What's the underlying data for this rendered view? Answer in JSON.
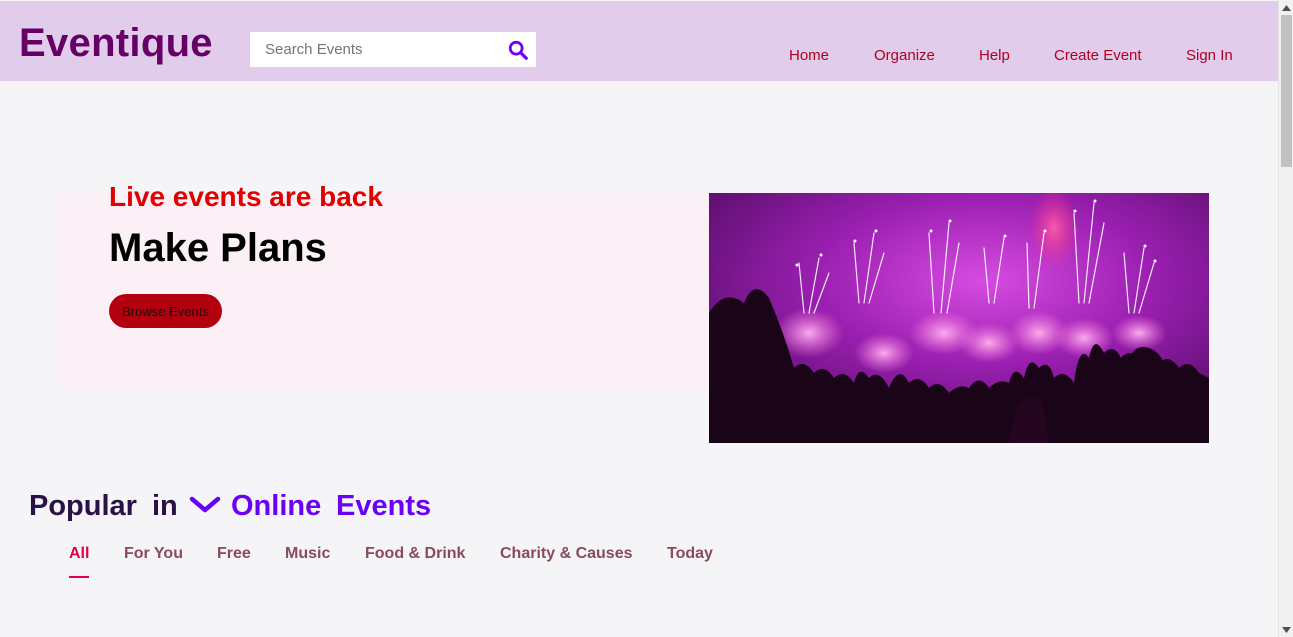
{
  "header": {
    "logo": "Eventique",
    "search_placeholder": "Search Events",
    "nav": [
      "Home",
      "Organize",
      "Help",
      "Create Event",
      "Sign In"
    ]
  },
  "hero": {
    "kicker": "Live events are back",
    "title": "Make Plans",
    "button": "Browse Events",
    "image": "concert-crowd-fireworks"
  },
  "popular": {
    "words": [
      "Popular",
      "in",
      "Online",
      "Events"
    ]
  },
  "tabs": {
    "items": [
      "All",
      "For You",
      "Free",
      "Music",
      "Food & Drink",
      "Charity & Causes",
      "Today"
    ],
    "active": "All"
  },
  "colors": {
    "header_bg": "#e2cceb",
    "logo": "#660066",
    "nav_link": "#b00020",
    "kicker": "#e00000",
    "button_bg": "#b3000f",
    "accent_purple": "#6a00f4",
    "tab_active": "#e0004d"
  }
}
